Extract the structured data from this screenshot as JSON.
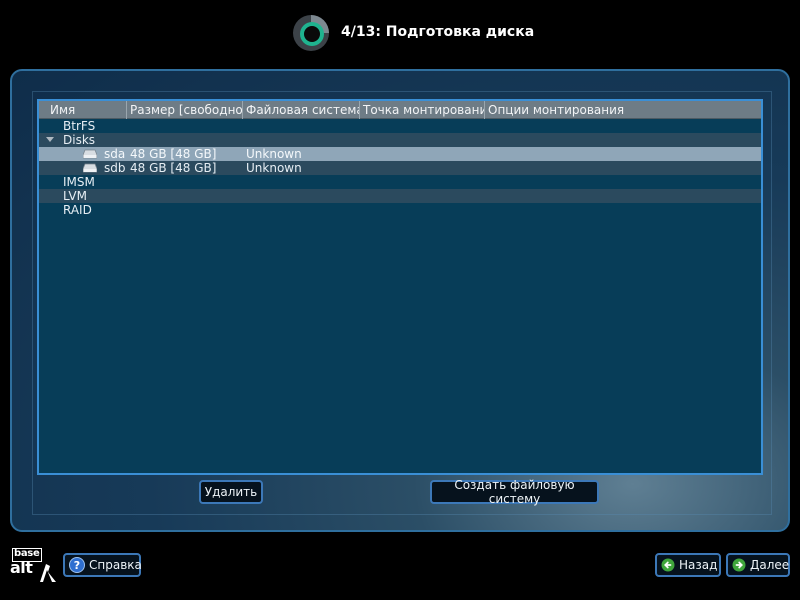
{
  "header": {
    "title": "4/13: Подготовка диска",
    "logo_icon": "alt-installer-ring-icon"
  },
  "tree": {
    "columns": [
      "Имя",
      "Размер [свободно]",
      "Файловая система",
      "Точка монтирования",
      "Опции монтирования"
    ],
    "rows": [
      {
        "name": "BtrFS"
      },
      {
        "name": "Disks",
        "expanded": true
      },
      {
        "name": "sda",
        "size": "48 GB [48 GB]",
        "fs": "Unknown",
        "selected": true
      },
      {
        "name": "sdb",
        "size": "48 GB [48 GB]",
        "fs": "Unknown"
      },
      {
        "name": "IMSM"
      },
      {
        "name": "LVM"
      },
      {
        "name": "RAID"
      }
    ]
  },
  "actions": {
    "delete_label": "Удалить",
    "create_fs_label": "Создать файловую систему"
  },
  "footer": {
    "brand_base": "base",
    "brand_alt": "alt",
    "help_label": "Справка",
    "back_label": "Назад",
    "next_label": "Далее"
  },
  "colors": {
    "accent_border": "#3a8fd6",
    "tree_background": "#073d58",
    "selected_row": "#8fa6b8"
  }
}
